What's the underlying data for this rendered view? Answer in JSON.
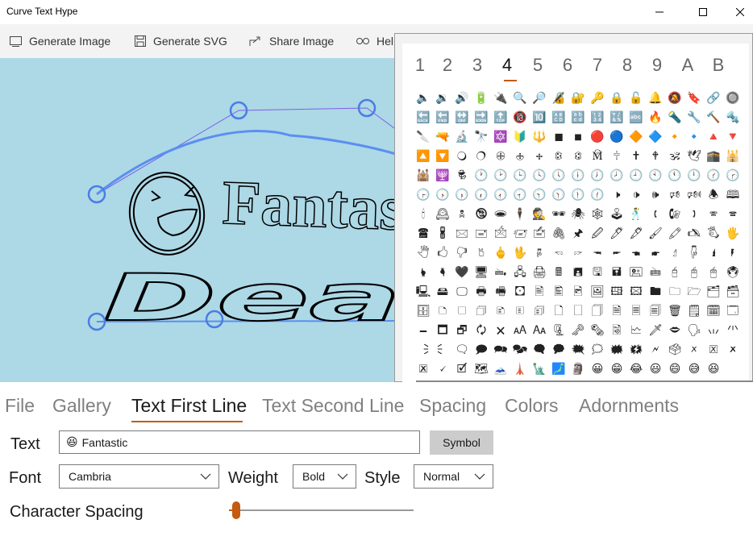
{
  "window": {
    "title": "Curve Text Hype"
  },
  "toolbar": {
    "generate_image": "Generate Image",
    "generate_svg": "Generate SVG",
    "share_image": "Share Image",
    "help": "Help"
  },
  "canvas": {
    "line1_text": "Fantas",
    "line2_text": "Dea",
    "background": "#add8e6",
    "handle_color": "#4a7de3"
  },
  "symbol_popup": {
    "pages": [
      "1",
      "2",
      "3",
      "4",
      "5",
      "6",
      "7",
      "8",
      "9",
      "A",
      "B"
    ],
    "selected_page": "4",
    "symbols": [
      "🔈",
      "🔉",
      "🔊",
      "🔋",
      "🔌",
      "🔍",
      "🔎",
      "🔏",
      "🔐",
      "🔑",
      "🔒",
      "🔓",
      "🔔",
      "🔕",
      "🔖",
      "🔗",
      "🔘",
      "🔙",
      "🔚",
      "🔛",
      "🔜",
      "🔝",
      "🔞",
      "🔟",
      "🔠",
      "🔡",
      "🔢",
      "🔣",
      "🔤",
      "🔥",
      "🔦",
      "🔧",
      "🔨",
      "🔩",
      "🔪",
      "🔫",
      "🔬",
      "🔭",
      "🔯",
      "🔰",
      "🔱",
      "◼",
      "◾",
      "🔴",
      "🔵",
      "🔶",
      "🔷",
      "🔸",
      "🔹",
      "🔺",
      "🔻",
      "🔼",
      "🔽",
      "🔾",
      "🔿",
      "🕀",
      "🕁",
      "🕂",
      "🕃",
      "🕄",
      "🕅",
      "🕆",
      "🕇",
      "🕈",
      "🕉",
      "🕊",
      "🕋",
      "🕌",
      "🕍",
      "🕎",
      "🕏",
      "🕐",
      "🕑",
      "🕒",
      "🕓",
      "🕔",
      "🕕",
      "🕖",
      "🕗",
      "🕘",
      "🕙",
      "🕚",
      "🕛",
      "🕜",
      "🕝",
      "🕞",
      "🕟",
      "🕠",
      "🕡",
      "🕢",
      "🕣",
      "🕤",
      "🕥",
      "🕦",
      "🕧",
      "🕨",
      "🕩",
      "🕪",
      "🕫",
      "🕬",
      "🕭",
      "🕮",
      "🕯",
      "🕰",
      "🕱",
      "🕲",
      "🕳",
      "🕴",
      "🕵",
      "🕶",
      "🕷",
      "🕸",
      "🕹",
      "🕺",
      "🕻",
      "🕼",
      "🕽",
      "🕾",
      "🕿",
      "🖀",
      "🖁",
      "🖂",
      "🖃",
      "🖄",
      "🖅",
      "🖆",
      "🖇",
      "🖈",
      "🖉",
      "🖊",
      "🖋",
      "🖌",
      "🖍",
      "🖎",
      "🖏",
      "🖐",
      "🖑",
      "🖒",
      "🖓",
      "🖔",
      "🖕",
      "🖖",
      "🖗",
      "🖘",
      "🖙",
      "🖚",
      "🖛",
      "🖜",
      "🖝",
      "🖞",
      "🖟",
      "🖠",
      "🖡",
      "🖢",
      "🖣",
      "🖤",
      "🖥",
      "🖦",
      "🖧",
      "🖨",
      "🖩",
      "🖪",
      "🖫",
      "🖬",
      "🖭",
      "🖮",
      "🖯",
      "🖰",
      "🖱",
      "🖲",
      "🖳",
      "🖴",
      "🖵",
      "🖶",
      "🖷",
      "🖸",
      "🖹",
      "🖺",
      "🖻",
      "🖼",
      "🖽",
      "🖾",
      "🖿",
      "🗀",
      "🗁",
      "🗂",
      "🗃",
      "🗄",
      "🗅",
      "🗆",
      "🗇",
      "🗈",
      "🗉",
      "🗊",
      "🗋",
      "🗌",
      "🗍",
      "🗎",
      "🗏",
      "🗐",
      "🗑",
      "🗒",
      "🗓",
      "🗔",
      "🗕",
      "🗖",
      "🗗",
      "🗘",
      "🗙",
      "🗚",
      "🗛",
      "🗜",
      "🗝",
      "🗞",
      "🗟",
      "🗠",
      "🗡",
      "🗢",
      "🗣",
      "🗤",
      "🗥",
      "🗦",
      "🗧",
      "🗨",
      "🗩",
      "🗪",
      "🗫",
      "🗬",
      "🗭",
      "🗮",
      "🗯",
      "🗰",
      "🗱",
      "🗲",
      "🗳",
      "🗴",
      "🗵",
      "🗶",
      "🗷",
      "🗸",
      "🗹",
      "🗺",
      "🗻",
      "🗼",
      "🗽",
      "🗾",
      "🗿",
      "😀",
      "😁",
      "😂",
      "😃",
      "😄",
      "😅",
      "😆"
    ]
  },
  "nav": {
    "tabs": [
      "File",
      "Gallery",
      "Text First Line",
      "Text Second Line",
      "Spacing",
      "Colors",
      "Adornments"
    ],
    "active": "Text First Line"
  },
  "form": {
    "text_label": "Text",
    "text_value": "Fantastic",
    "text_emoji": "😆",
    "symbol_button": "Symbol",
    "font_label": "Font",
    "font_value": "Cambria",
    "weight_label": "Weight",
    "weight_value": "Bold",
    "style_label": "Style",
    "style_value": "Normal",
    "char_spacing_label": "Character Spacing",
    "char_spacing_value": 0.04
  },
  "colors": {
    "accent": "#c55a11",
    "curve": "#5b8ff0",
    "guide": "#7b5fe8"
  }
}
